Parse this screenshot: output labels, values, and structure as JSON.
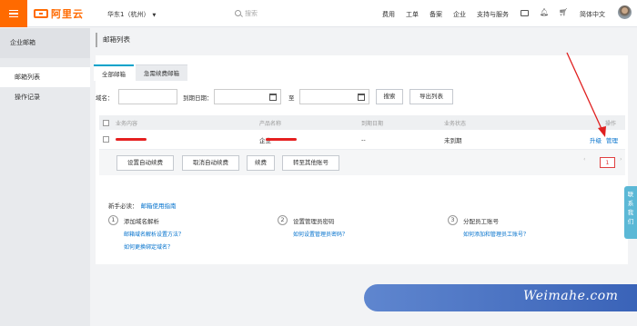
{
  "topbar": {
    "logo_text": "阿里云",
    "region": "华东1（杭州）",
    "search_placeholder": "搜索",
    "nav": [
      "费用",
      "工单",
      "备案",
      "企业",
      "支持与服务"
    ],
    "language": "简体中文"
  },
  "sidebar": {
    "title": "企业邮箱",
    "items": [
      {
        "label": "邮箱列表",
        "active": true
      },
      {
        "label": "操作记录",
        "active": false
      }
    ]
  },
  "main": {
    "page_title": "邮箱列表",
    "tabs": [
      {
        "label": "全部邮箱",
        "active": true
      },
      {
        "label": "急需续费邮箱",
        "active": false
      }
    ],
    "filters": {
      "domain_label": "域名：",
      "expiry_label": "到期日期：",
      "to_label": "至",
      "search_button": "搜索",
      "export_button": "导出列表"
    },
    "table": {
      "columns": [
        "业务内容",
        "产品名称",
        "到期日期",
        "业务状态",
        "操作"
      ],
      "rows": [
        {
          "content": "",
          "product": "企业",
          "expiry": "--",
          "status": "未到期",
          "actions": [
            "升级",
            "管理"
          ]
        }
      ],
      "footer_buttons": [
        "设置自动续费",
        "取消自动续费",
        "续费",
        "转至其他账号"
      ],
      "pagination": {
        "prev": "‹",
        "current": "1",
        "next": "›"
      }
    },
    "guide": {
      "heading": "新手必读：",
      "heading_link": "邮箱使用指南",
      "steps": [
        {
          "num": "1",
          "title": "添加域名解析",
          "links": [
            "邮箱域名解析设置方法？",
            "如何更换绑定域名？"
          ]
        },
        {
          "num": "2",
          "title": "设置管理员密码",
          "links": [
            "如何设置管理员密码？"
          ]
        },
        {
          "num": "3",
          "title": "分配员工账号",
          "links": [
            "如何添加和管理员工账号？"
          ]
        }
      ]
    }
  },
  "side_tab": {
    "chars": [
      "联",
      "系",
      "我",
      "们"
    ]
  },
  "watermark": "Weimahe.com",
  "colors": {
    "brand": "#ff6a00",
    "link": "#0070cc",
    "tab_accent": "#00a2ca",
    "annotation_arrow": "#e02020"
  }
}
